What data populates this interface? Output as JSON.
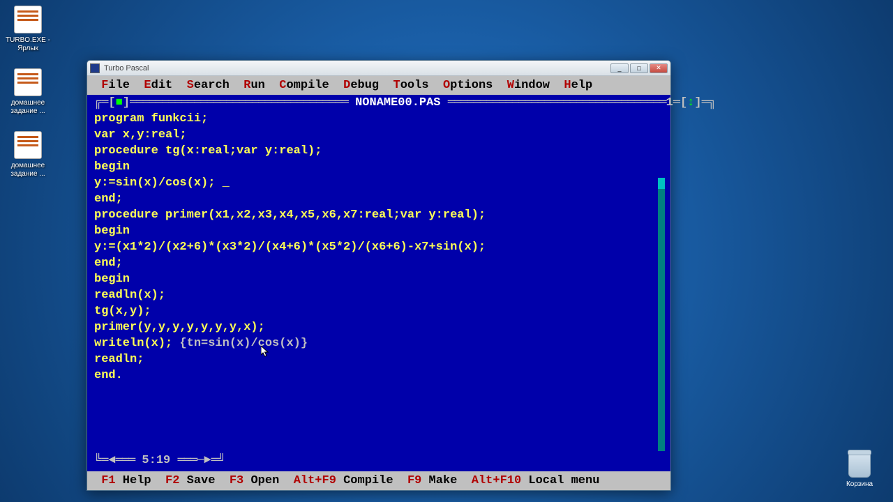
{
  "desktop": {
    "icons": [
      {
        "label": "TURBO.EXE - Ярлык"
      },
      {
        "label": "домашнее задание ..."
      },
      {
        "label": "домашнее задание ..."
      }
    ],
    "recycle": "Корзина"
  },
  "window": {
    "title": "Turbo Pascal",
    "btn_min": "_",
    "btn_max": "□",
    "btn_close": "✕"
  },
  "menu": [
    {
      "hot": "F",
      "rest": "ile"
    },
    {
      "hot": "E",
      "rest": "dit"
    },
    {
      "hot": "S",
      "rest": "earch"
    },
    {
      "hot": "R",
      "rest": "un"
    },
    {
      "hot": "C",
      "rest": "ompile"
    },
    {
      "hot": "D",
      "rest": "ebug"
    },
    {
      "hot": "T",
      "rest": "ools"
    },
    {
      "hot": "O",
      "rest": "ptions"
    },
    {
      "hot": "W",
      "rest": "indow"
    },
    {
      "hot": "H",
      "rest": "elp"
    }
  ],
  "editor": {
    "filename": "NONAME00.PAS",
    "window_number": "1",
    "cursor_pos": "5:19",
    "code_lines": [
      {
        "t": "program funkcii;"
      },
      {
        "t": "var x,y:real;"
      },
      {
        "t": "procedure tg(x:real;var y:real);"
      },
      {
        "t": "begin"
      },
      {
        "t": "y:=sin(x)/cos(x); _"
      },
      {
        "t": "end;"
      },
      {
        "t": "procedure primer(x1,x2,x3,x4,x5,x6,x7:real;var y:real);"
      },
      {
        "t": "begin"
      },
      {
        "t": "y:=(x1*2)/(x2+6)*(x3*2)/(x4+6)*(x5*2)/(x6+6)-x7+sin(x);"
      },
      {
        "t": "end;"
      },
      {
        "t": "begin"
      },
      {
        "t": "readln(x);"
      },
      {
        "t": "tg(x,y);"
      },
      {
        "t": "primer(y,y,y,y,y,y,y,x);"
      },
      {
        "t": "writeln(x); ",
        "comment": "{tn=sin(x)/cos(x)}"
      },
      {
        "t": "readln;"
      },
      {
        "t": "end."
      }
    ]
  },
  "status": [
    {
      "key": "F1",
      "label": " Help"
    },
    {
      "key": "F2",
      "label": " Save"
    },
    {
      "key": "F3",
      "label": " Open"
    },
    {
      "key": "Alt+F9",
      "label": " Compile"
    },
    {
      "key": "F9",
      "label": " Make"
    },
    {
      "key": "Alt+F10",
      "label": " Local menu"
    }
  ]
}
